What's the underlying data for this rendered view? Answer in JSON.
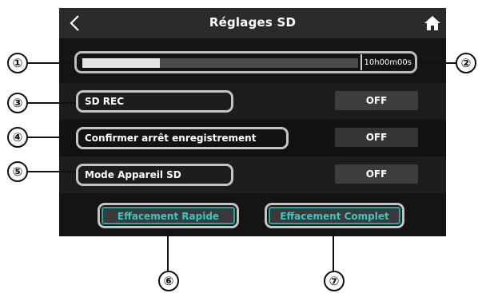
{
  "header": {
    "title": "Réglages SD"
  },
  "capacity": {
    "used_fraction": 0.28,
    "remaining_time": "10h00m00s"
  },
  "settings": [
    {
      "label": "SD REC",
      "value": "OFF"
    },
    {
      "label": "Confirmer arrêt enregistrement",
      "value": "OFF"
    },
    {
      "label": "Mode Appareil SD",
      "value": "OFF"
    }
  ],
  "actions": {
    "quick_erase": "Effacement Rapide",
    "full_erase": "Effacement Complet"
  },
  "callouts": [
    "①",
    "②",
    "③",
    "④",
    "⑤",
    "⑥",
    "⑦"
  ],
  "colors": {
    "screen_bg": "#141414",
    "titlebar_bg": "#2b2b2b",
    "accent": "#3fc7bf",
    "toggle_bg": "#3d3d3d"
  },
  "icons": {
    "back": "chevron-left-icon",
    "home": "home-icon"
  }
}
